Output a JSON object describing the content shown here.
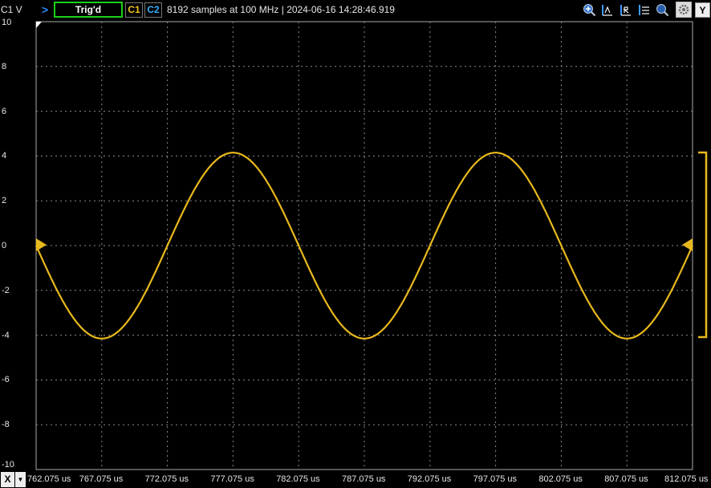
{
  "toolbar": {
    "channel_label": "C1 V",
    "trigger_status": "Trig'd",
    "ch1_button": "C1",
    "ch2_button": "C2",
    "acquisition_info": "8192 samples at 100 MHz | 2024-06-16 14:28:46.919",
    "y_button": "Y",
    "icons": [
      "zoom-in-icon",
      "cursor-a-icon",
      "cursor-b-icon",
      "cursor-list-icon",
      "magnify-icon",
      "settings-icon"
    ]
  },
  "x_button": "X",
  "colors": {
    "trace": "#e8b91c",
    "grid": "#8a8a8a",
    "background": "#000000"
  },
  "chart_data": {
    "type": "line",
    "y_tick_labels": [
      "10",
      "8",
      "6",
      "4",
      "2",
      "0",
      "-2",
      "-4",
      "-6",
      "-8",
      "-10"
    ],
    "x_tick_labels": [
      "762.075 us",
      "767.075 us",
      "772.075 us",
      "777.075 us",
      "782.075 us",
      "787.075 us",
      "792.075 us",
      "797.075 us",
      "802.075 us",
      "807.075 us",
      "812.075 us"
    ],
    "ylim": [
      -10,
      10
    ],
    "xlim": [
      762.075,
      812.075
    ],
    "series": [
      {
        "amplitude": 4.15,
        "period_us": 20,
        "peak_times_us": [
          777.075,
          797.075
        ],
        "trough_times_us": [
          766.775,
          786.775,
          806.775
        ]
      }
    ]
  }
}
